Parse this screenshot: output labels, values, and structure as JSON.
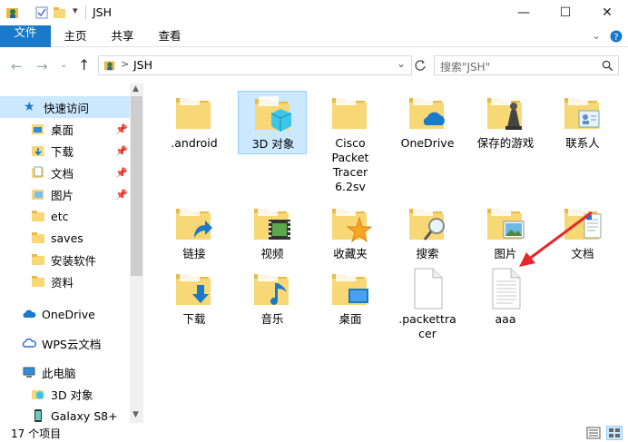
{
  "window": {
    "title": "JSH",
    "minimize": "—",
    "maximize": "☐",
    "close": "✕"
  },
  "ribbon": {
    "tabs": [
      "文件",
      "主页",
      "共享",
      "查看"
    ]
  },
  "address": {
    "separator": ">",
    "path": "JSH",
    "search_placeholder": "搜索\"JSH\""
  },
  "sidebar": {
    "quick_access": "快速访问",
    "items": [
      {
        "label": "桌面",
        "pinned": true
      },
      {
        "label": "下载",
        "pinned": true
      },
      {
        "label": "文档",
        "pinned": true
      },
      {
        "label": "图片",
        "pinned": true
      },
      {
        "label": "etc",
        "pinned": false
      },
      {
        "label": "saves",
        "pinned": false
      },
      {
        "label": "安装软件",
        "pinned": false
      },
      {
        "label": "资料",
        "pinned": false
      }
    ],
    "onedrive": "OneDrive",
    "wps": "WPS云文档",
    "this_pc": "此电脑",
    "objects3d": "3D 对象",
    "galaxy": "Galaxy S8+"
  },
  "files": [
    {
      "name": ".android",
      "type": "folder"
    },
    {
      "name": "3D 对象",
      "type": "folder-3d"
    },
    {
      "name": "Cisco Packet Tracer 6.2sv",
      "type": "folder"
    },
    {
      "name": "OneDrive",
      "type": "folder-cloud"
    },
    {
      "name": "保存的游戏",
      "type": "folder-games"
    },
    {
      "name": "联系人",
      "type": "folder-contacts"
    },
    {
      "name": "链接",
      "type": "folder-link"
    },
    {
      "name": "视频",
      "type": "folder-video"
    },
    {
      "name": "收藏夹",
      "type": "folder-star"
    },
    {
      "name": "搜索",
      "type": "folder-search"
    },
    {
      "name": "图片",
      "type": "folder-pictures"
    },
    {
      "name": "文档",
      "type": "folder-docs"
    },
    {
      "name": "下载",
      "type": "folder-download"
    },
    {
      "name": "音乐",
      "type": "folder-music"
    },
    {
      "name": "桌面",
      "type": "folder-desktop"
    },
    {
      "name": ".packettracer",
      "type": "file"
    },
    {
      "name": "aaa",
      "type": "text-file"
    }
  ],
  "status": {
    "count": "17 个项目"
  },
  "colors": {
    "accent": "#1979ca",
    "folder": "#f8d775",
    "folder_dark": "#e9b949",
    "selection": "#cce8ff",
    "arrow": "#e8262a"
  }
}
